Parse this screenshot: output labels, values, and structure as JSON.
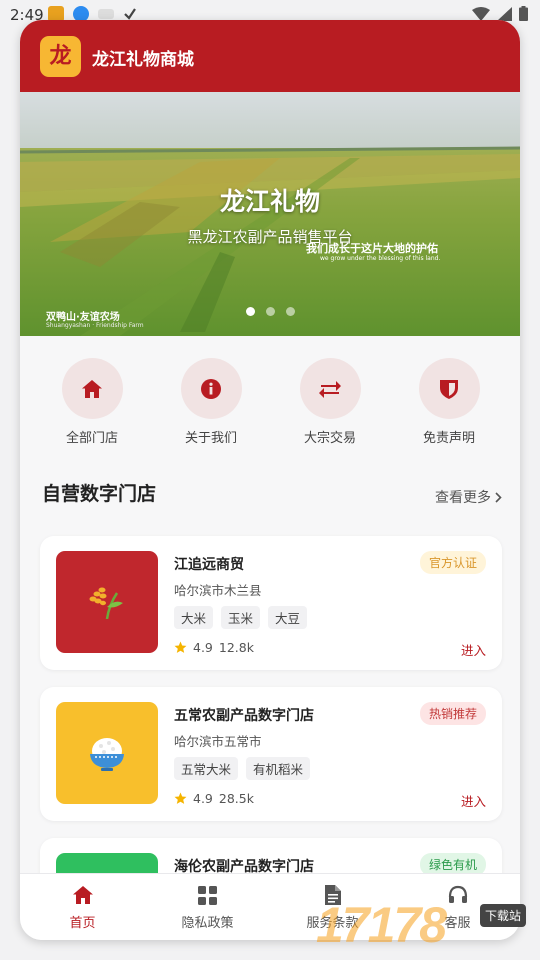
{
  "status_bar": {
    "time": "2:49"
  },
  "header": {
    "logo_char": "龙",
    "title": "龙江礼物商城"
  },
  "banner": {
    "title": "龙江礼物",
    "subtitle": "黑龙江农副产品销售平台",
    "slogan": "我们成长于这片大地的护佑",
    "slogan_en": "we grow under the blessing of this land.",
    "farm": "双鸭山·友谊农场",
    "farm_en": "Shuangyashan · Friendship Farm",
    "slides": 3,
    "active_slide": 1
  },
  "quick_nav": [
    {
      "label": "全部门店",
      "icon": "home-icon"
    },
    {
      "label": "关于我们",
      "icon": "info-icon"
    },
    {
      "label": "大宗交易",
      "icon": "exchange-icon"
    },
    {
      "label": "免责声明",
      "icon": "shield-icon"
    }
  ],
  "section": {
    "title": "自营数字门店",
    "more": "查看更多"
  },
  "stores": [
    {
      "name": "江追远商贸",
      "location": "哈尔滨市木兰县",
      "badge": "官方认证",
      "tags": [
        "大米",
        "玉米",
        "大豆"
      ],
      "rating": "4.9",
      "sales": "12.8k",
      "enter": "进入",
      "icon": "grain-icon",
      "thumb_color": "#c0272d",
      "badge_bg": "#fff4d9",
      "badge_color": "#d9962b"
    },
    {
      "name": "五常农副产品数字门店",
      "location": "哈尔滨市五常市",
      "badge": "热销推荐",
      "tags": [
        "五常大米",
        "有机稻米"
      ],
      "rating": "4.9",
      "sales": "28.5k",
      "enter": "进入",
      "icon": "rice-bowl-icon",
      "thumb_color": "#f8bf2c",
      "badge_bg": "#fde4e4",
      "badge_color": "#c23a3a"
    },
    {
      "name": "海伦农副产品数字门店",
      "location": "",
      "badge": "绿色有机",
      "tags": [],
      "rating": "",
      "sales": "",
      "enter": "",
      "icon": "leaf-icon",
      "thumb_color": "#2fbf5f",
      "badge_bg": "#e1f6e6",
      "badge_color": "#2a9a4a"
    }
  ],
  "tabs": [
    {
      "label": "首页",
      "icon": "home-icon",
      "active": true
    },
    {
      "label": "隐私政策",
      "icon": "grid-icon",
      "active": false
    },
    {
      "label": "服务条款",
      "icon": "document-icon",
      "active": false
    },
    {
      "label": "客服",
      "icon": "headset-icon",
      "active": false
    }
  ],
  "watermark": {
    "text": "17178",
    "badge": "下载站"
  },
  "colors": {
    "brand": "#b81c22",
    "logo_bg": "#f7b733",
    "quick_circle": "#f1e3e3"
  }
}
